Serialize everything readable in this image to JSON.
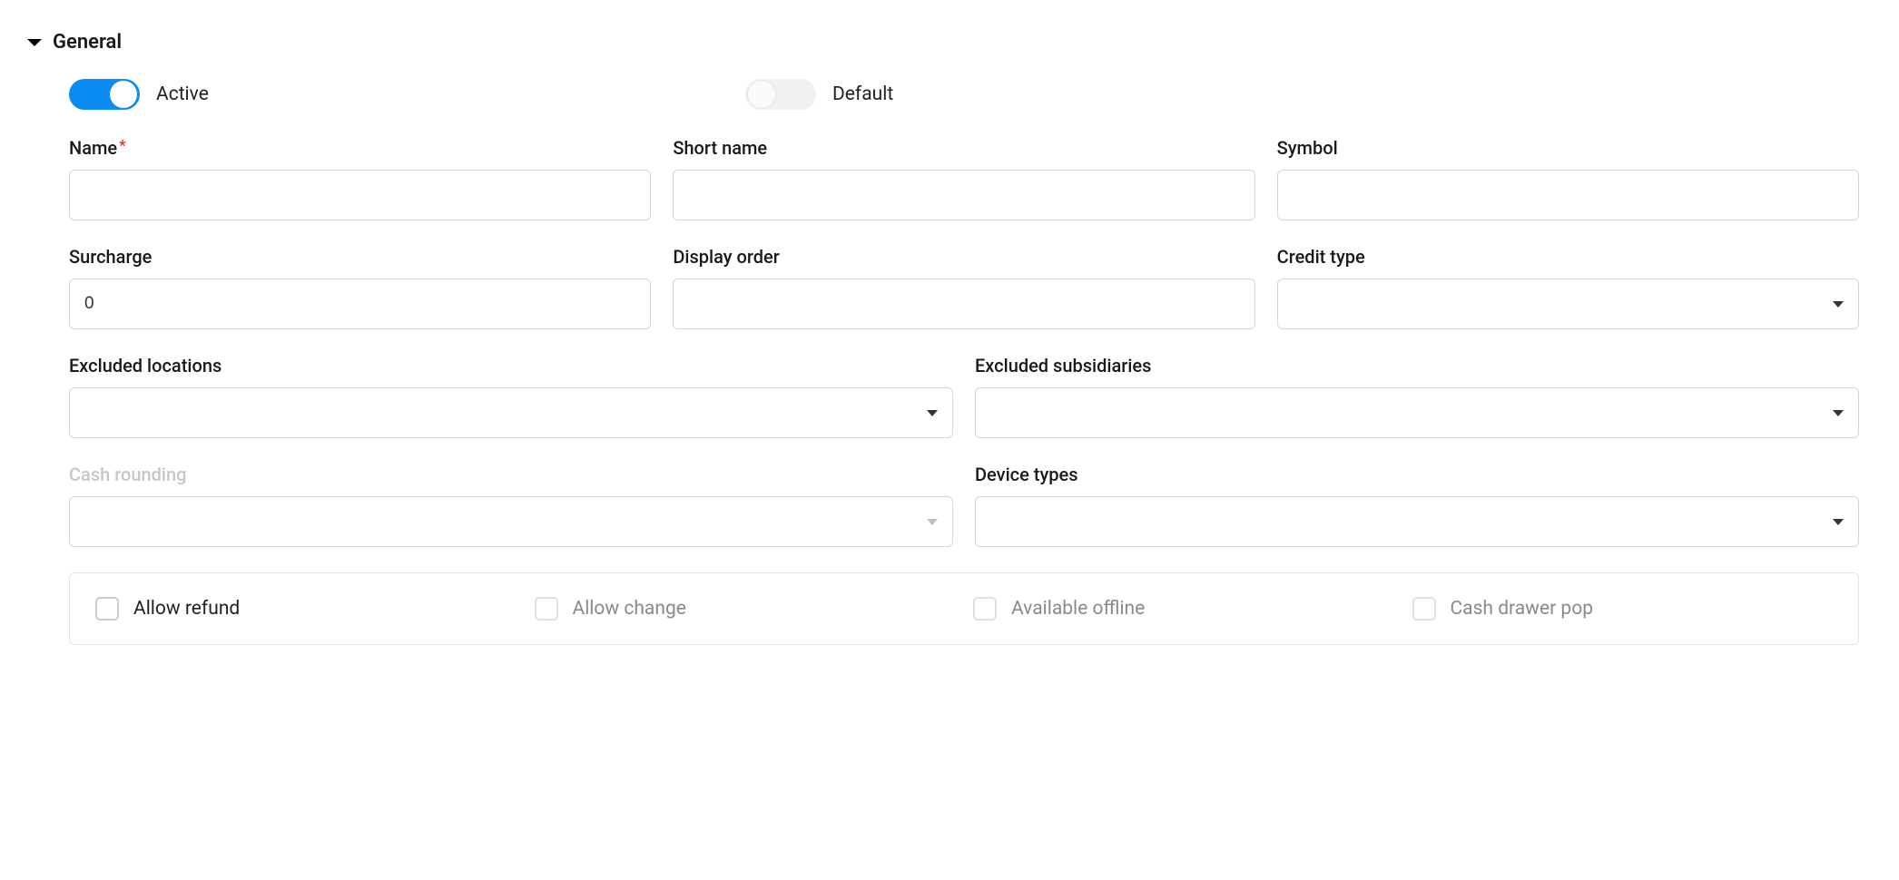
{
  "section": {
    "title": "General"
  },
  "toggles": {
    "active": {
      "label": "Active",
      "on": true
    },
    "default": {
      "label": "Default",
      "on": false
    }
  },
  "fields": {
    "name": {
      "label": "Name",
      "value": ""
    },
    "short_name": {
      "label": "Short name",
      "value": ""
    },
    "symbol": {
      "label": "Symbol",
      "value": ""
    },
    "surcharge": {
      "label": "Surcharge",
      "value": "0"
    },
    "display_order": {
      "label": "Display order",
      "value": ""
    },
    "credit_type": {
      "label": "Credit type",
      "value": ""
    },
    "excluded_locations": {
      "label": "Excluded locations",
      "value": ""
    },
    "excluded_subsidiaries": {
      "label": "Excluded subsidiaries",
      "value": ""
    },
    "cash_rounding": {
      "label": "Cash rounding",
      "value": ""
    },
    "device_types": {
      "label": "Device types",
      "value": ""
    }
  },
  "checkboxes": {
    "allow_refund": {
      "label": "Allow refund",
      "checked": false,
      "disabled": false
    },
    "allow_change": {
      "label": "Allow change",
      "checked": false,
      "disabled": true
    },
    "available_offline": {
      "label": "Available offline",
      "checked": false,
      "disabled": true
    },
    "cash_drawer_pop": {
      "label": "Cash drawer pop",
      "checked": false,
      "disabled": true
    }
  }
}
